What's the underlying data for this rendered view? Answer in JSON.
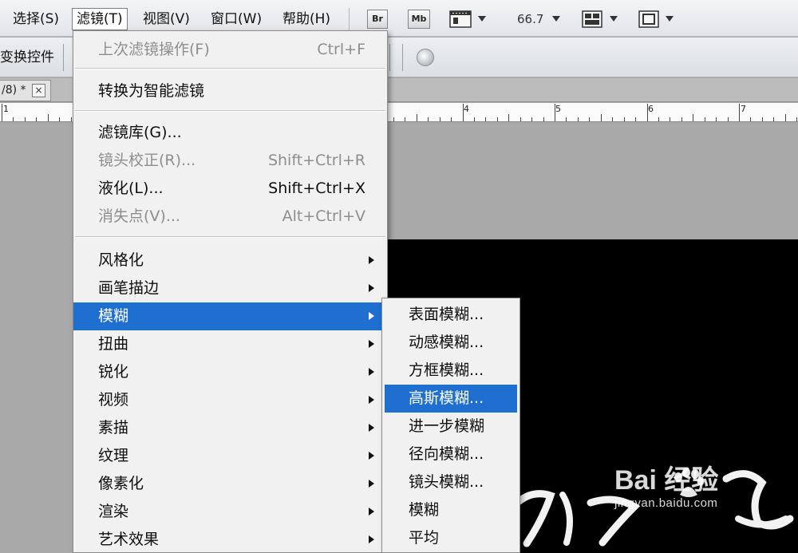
{
  "menubar": {
    "items": [
      {
        "label": "选择(S)"
      },
      {
        "label": "滤镜(T)",
        "active": true
      },
      {
        "label": "视图(V)"
      },
      {
        "label": "窗口(W)"
      },
      {
        "label": "帮助(H)"
      }
    ],
    "icons": {
      "bridge": "Br",
      "mini_bridge": "Mb"
    },
    "zoom": "66.7"
  },
  "options_bar": {
    "label": "变换控件"
  },
  "document_tab": {
    "title": "/8) *",
    "close": "×"
  },
  "ruler": {
    "numbers": [
      "1",
      "4",
      "5",
      "6",
      "7"
    ]
  },
  "filter_menu": {
    "items": [
      {
        "label": "上次滤镜操作(F)",
        "shortcut": "Ctrl+F",
        "disabled": true
      },
      {
        "label": "转换为智能滤镜"
      },
      {
        "label": "滤镜库(G)..."
      },
      {
        "label": "镜头校正(R)...",
        "shortcut": "Shift+Ctrl+R",
        "disabled": true
      },
      {
        "label": "液化(L)...",
        "shortcut": "Shift+Ctrl+X"
      },
      {
        "label": "消失点(V)...",
        "shortcut": "Alt+Ctrl+V",
        "disabled": true
      },
      {
        "label": "风格化",
        "submenu": true
      },
      {
        "label": "画笔描边",
        "submenu": true
      },
      {
        "label": "模糊",
        "submenu": true,
        "highlighted": true
      },
      {
        "label": "扭曲",
        "submenu": true
      },
      {
        "label": "锐化",
        "submenu": true
      },
      {
        "label": "视频",
        "submenu": true
      },
      {
        "label": "素描",
        "submenu": true
      },
      {
        "label": "纹理",
        "submenu": true
      },
      {
        "label": "像素化",
        "submenu": true
      },
      {
        "label": "渲染",
        "submenu": true
      },
      {
        "label": "艺术效果",
        "submenu": true
      }
    ]
  },
  "blur_submenu": {
    "items": [
      {
        "label": "表面模糊..."
      },
      {
        "label": "动感模糊..."
      },
      {
        "label": "方框模糊..."
      },
      {
        "label": "高斯模糊...",
        "highlighted": true
      },
      {
        "label": "进一步模糊"
      },
      {
        "label": "径向模糊..."
      },
      {
        "label": "镜头模糊..."
      },
      {
        "label": "模糊"
      },
      {
        "label": "平均"
      }
    ]
  },
  "watermark": {
    "logo": "Bai  经验",
    "url": "jingyan.baidu.com"
  },
  "colors": {
    "highlight": "#1e6fcf",
    "menu_bg": "#f1f1f1",
    "disabled": "#8e8e8e",
    "canvas": "#000000"
  }
}
